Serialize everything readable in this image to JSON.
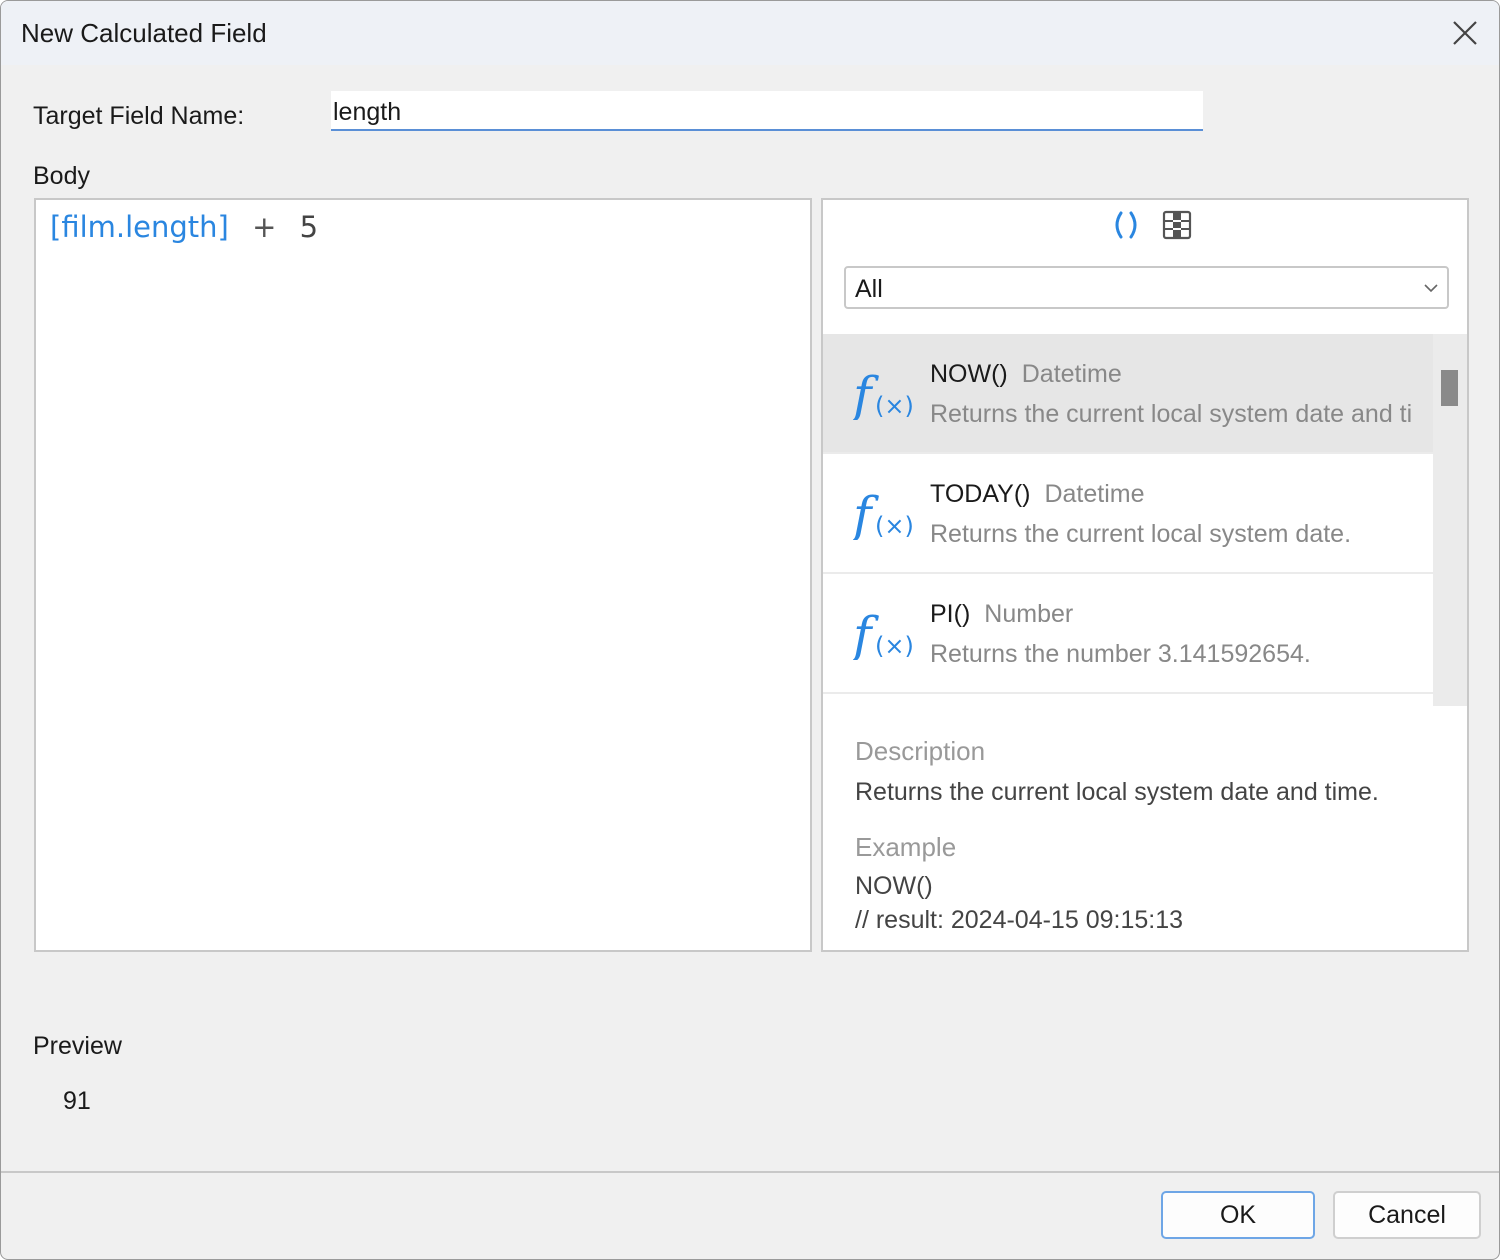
{
  "window": {
    "title": "New Calculated Field"
  },
  "target": {
    "label": "Target Field Name:",
    "value": "length"
  },
  "body": {
    "label": "Body",
    "expression": {
      "field": "[film.length]",
      "operator": "+",
      "operand": "5"
    }
  },
  "functions": {
    "toolbar": {
      "icons": [
        "parentheses-icon",
        "table-columns-icon"
      ]
    },
    "filter": {
      "selected": "All"
    },
    "items": [
      {
        "name": "NOW()",
        "type": "Datetime",
        "desc": "Returns the current local system date and ti"
      },
      {
        "name": "TODAY()",
        "type": "Datetime",
        "desc": "Returns the current local system date."
      },
      {
        "name": "PI()",
        "type": "Number",
        "desc": "Returns the number 3.141592654."
      }
    ],
    "detail": {
      "description_heading": "Description",
      "description": "Returns the current local system date and time.",
      "example_heading": "Example",
      "example_code": "NOW()",
      "example_result": "// result: 2024-04-15 09:15:13"
    }
  },
  "preview": {
    "label": "Preview",
    "value": "91"
  },
  "buttons": {
    "ok": "OK",
    "cancel": "Cancel"
  },
  "colors": {
    "accent": "#2a86e0",
    "focus_border": "#6ea6e6",
    "selected_row": "#e6e6e6"
  }
}
